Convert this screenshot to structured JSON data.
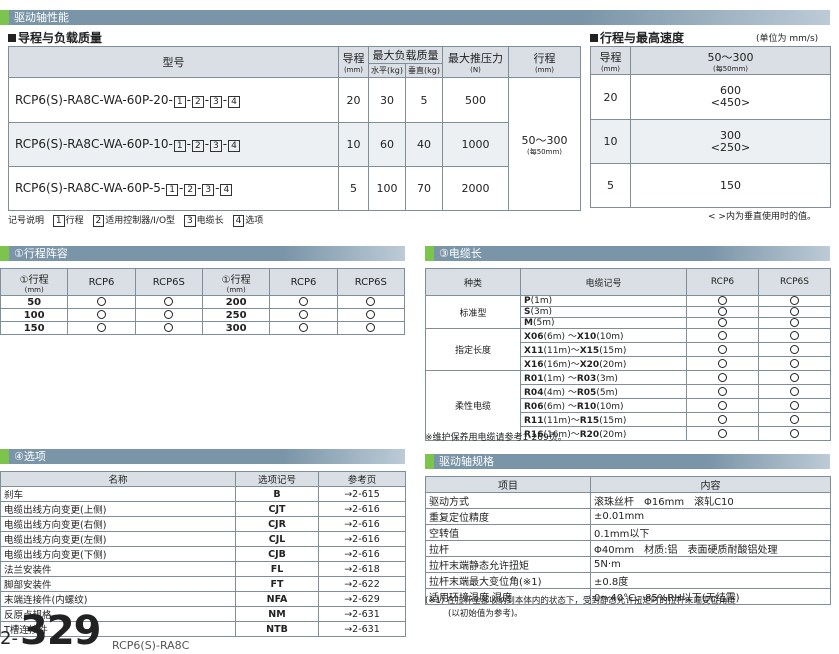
{
  "title_bar": "驱动轴性能",
  "guide": {
    "heading": "导程与负载质量",
    "headers": {
      "model": "型号",
      "lead": "导程",
      "lead_unit": "(mm)",
      "max_load": "最大负载质量",
      "horizontal": "水平(kg)",
      "vertical": "垂直(kg)",
      "max_thrust": "最大推压力",
      "thrust_unit": "(N)",
      "stroke": "行程",
      "stroke_unit": "(mm)"
    },
    "rows": [
      {
        "model": "RCP6(S)-RA8C-WA-60P-20-",
        "lead": "20",
        "h": "30",
        "v": "5",
        "thrust": "500"
      },
      {
        "model": "RCP6(S)-RA8C-WA-60P-10-",
        "lead": "10",
        "h": "60",
        "v": "40",
        "thrust": "1000"
      },
      {
        "model": "RCP6(S)-RA8C-WA-60P-5-",
        "lead": "5",
        "h": "100",
        "v": "70",
        "thrust": "2000"
      }
    ],
    "stroke_value": "50～300",
    "stroke_note": "(每50mm)",
    "boxes": [
      "1",
      "2",
      "3",
      "4"
    ],
    "legend": {
      "label": "记号说明",
      "items": [
        {
          "n": "1",
          "t": "行程"
        },
        {
          "n": "2",
          "t": "适用控制器/I/O型"
        },
        {
          "n": "3",
          "t": "电缆长"
        },
        {
          "n": "4",
          "t": "选项"
        }
      ]
    }
  },
  "speed": {
    "heading": "行程与最高速度",
    "unit": "(单位为 mm/s)",
    "headers": {
      "lead": "导程",
      "lead_unit": "(mm)",
      "range": "50～300",
      "range_unit": "(每50mm)"
    },
    "rows": [
      {
        "lead": "20",
        "v": "600",
        "v2": "<450>"
      },
      {
        "lead": "10",
        "v": "300",
        "v2": "<250>"
      },
      {
        "lead": "5",
        "v": "150",
        "v2": ""
      }
    ],
    "note": "< >内为垂直使用时的值。"
  },
  "stroke_list": {
    "title": "①行程阵容",
    "headers": {
      "stroke": "①行程",
      "unit": "(mm)",
      "c1": "RCP6",
      "c2": "RCP6S"
    },
    "left": [
      "50",
      "100",
      "150"
    ],
    "right": [
      "200",
      "250",
      "300"
    ]
  },
  "cable": {
    "title": "③电缆长",
    "headers": {
      "kind": "种类",
      "code": "电缆记号",
      "c1": "RCP6",
      "c2": "RCP6S"
    },
    "groups": [
      {
        "kind": "标准型",
        "rows": [
          {
            "c": "P",
            "l": "(1m)"
          },
          {
            "c": "S",
            "l": "(3m)"
          },
          {
            "c": "M",
            "l": "(5m)"
          }
        ]
      },
      {
        "kind": "指定长度",
        "rows": [
          {
            "c": "X06",
            "l": "(6m) ～",
            "c2": "X10",
            "l2": "(10m)"
          },
          {
            "c": "X11",
            "l": "(11m)～",
            "c2": "X15",
            "l2": "(15m)"
          },
          {
            "c": "X16",
            "l": "(16m)～",
            "c2": "X20",
            "l2": "(20m)"
          }
        ]
      },
      {
        "kind": "柔性电缆",
        "rows": [
          {
            "c": "R01",
            "l": "(1m) ～",
            "c2": "R03",
            "l2": "(3m)"
          },
          {
            "c": "R04",
            "l": "(4m) ～",
            "c2": "R05",
            "l2": "(5m)"
          },
          {
            "c": "R06",
            "l": "(6m) ～",
            "c2": "R10",
            "l2": "(10m)"
          },
          {
            "c": "R11",
            "l": "(11m)～",
            "c2": "R15",
            "l2": "(15m)"
          },
          {
            "c": "R16",
            "l": "(16m)～",
            "c2": "R20",
            "l2": "(20m)"
          }
        ]
      }
    ],
    "note": "※维护保养用电缆请参考1-269页。"
  },
  "options": {
    "title": "④选项",
    "headers": {
      "name": "名称",
      "code": "选项记号",
      "page": "参考页"
    },
    "rows": [
      {
        "n": "刹车",
        "c": "B",
        "p": "→2-615"
      },
      {
        "n": "电缆出线方向变更(上侧)",
        "c": "CJT",
        "p": "→2-616"
      },
      {
        "n": "电缆出线方向变更(右侧)",
        "c": "CJR",
        "p": "→2-616"
      },
      {
        "n": "电缆出线方向变更(左侧)",
        "c": "CJL",
        "p": "→2-616"
      },
      {
        "n": "电缆出线方向变更(下侧)",
        "c": "CJB",
        "p": "→2-616"
      },
      {
        "n": "法兰安装件",
        "c": "FL",
        "p": "→2-618"
      },
      {
        "n": "脚部安装件",
        "c": "FT",
        "p": "→2-622"
      },
      {
        "n": "末端连接件(内螺纹)",
        "c": "NFA",
        "p": "→2-629"
      },
      {
        "n": "反原点规格",
        "c": "NM",
        "p": "→2-631"
      },
      {
        "n": "T槽连接件",
        "c": "NTB",
        "p": "→2-631"
      }
    ]
  },
  "spec": {
    "title": "驱动轴规格",
    "headers": {
      "item": "项目",
      "content": "内容"
    },
    "rows": [
      {
        "i": "驱动方式",
        "v": "滚珠丝杆　Φ16mm　滚轧C10"
      },
      {
        "i": "重复定位精度",
        "v": "±0.01mm"
      },
      {
        "i": "空转值",
        "v": "0.1mm以下"
      },
      {
        "i": "拉杆",
        "v": "Φ40mm　材质:铝　表面硬质耐酸铝处理"
      },
      {
        "i": "拉杆末端静态允许扭矩",
        "v": "5N·m"
      },
      {
        "i": "拉杆末端最大变位角(※1)",
        "v": "±0.8度"
      },
      {
        "i": "适用环境温度·湿度",
        "v": "0～40°C、85%RH以下(无结露)"
      }
    ],
    "note1": "(※1) 在拉杆全部收纳到本体内的状态下，受到静态允许扭矩时的拉杆末端变位角度",
    "note2": "(以初始值为参考)。"
  },
  "footer": {
    "prefix": "2-",
    "page": "329",
    "model": "RCP6(S)-RA8C"
  },
  "colors": {
    "bar": "#7a95a8",
    "accent": "#7cc44d",
    "header": "#d9dfe4"
  }
}
